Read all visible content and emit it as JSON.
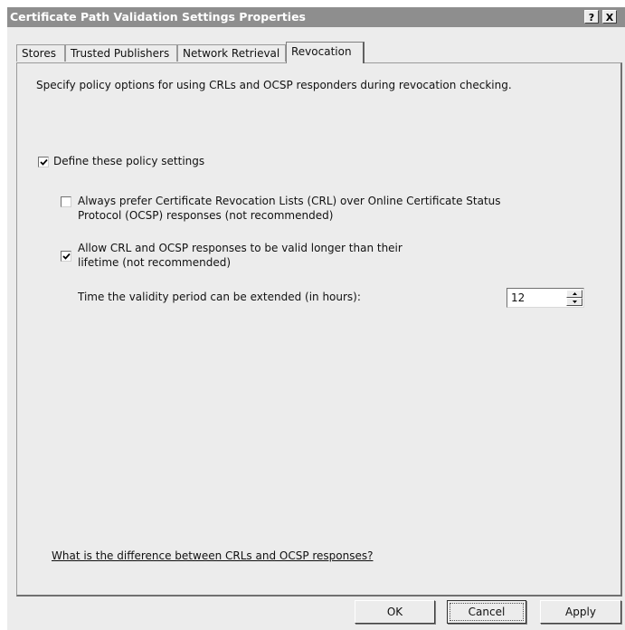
{
  "window": {
    "title": "Certificate Path Validation Settings Properties",
    "help_button": "?",
    "close_button": "X"
  },
  "tabs": [
    {
      "label": "Stores",
      "active": false
    },
    {
      "label": "Trusted Publishers",
      "active": false
    },
    {
      "label": "Network Retrieval",
      "active": false
    },
    {
      "label": "Revocation",
      "active": true
    }
  ],
  "revocation": {
    "description": "Specify policy options for using CRLs and OCSP responders during revocation checking.",
    "define_policy": {
      "label": "Define these policy settings",
      "checked": true
    },
    "prefer_crl": {
      "line1": "Always prefer Certificate Revocation Lists (CRL) over Online Certificate Status",
      "line2": "Protocol (OCSP) responses (not recommended)",
      "checked": false
    },
    "allow_valid_longer": {
      "line1": "Allow CRL and OCSP responses to be valid longer than their",
      "line2": "lifetime (not recommended)",
      "checked": true
    },
    "validity_extension": {
      "label": "Time the validity period can be extended (in hours):",
      "value": "12"
    },
    "help_link": "What is the difference between CRLs and OCSP responses?"
  },
  "buttons": {
    "ok": "OK",
    "cancel": "Cancel",
    "apply": "Apply"
  },
  "colors": {
    "titlebar": "#8e8e8e",
    "dialog_background": "#ececec"
  }
}
